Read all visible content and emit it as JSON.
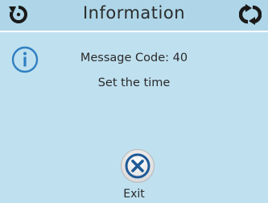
{
  "header": {
    "title": "Information",
    "left_icon": "back-rotate-icon",
    "right_icon": "refresh-cycle-icon"
  },
  "message": {
    "icon": "info-icon",
    "code_line": "Message Code: 40",
    "text": "Set the time"
  },
  "exit": {
    "icon": "close-x-icon",
    "label": "Exit"
  },
  "colors": {
    "background": "#bfe0ef",
    "header": "#aed6e8",
    "accent_blue": "#2f7fc1",
    "text": "#2a2a2a"
  }
}
